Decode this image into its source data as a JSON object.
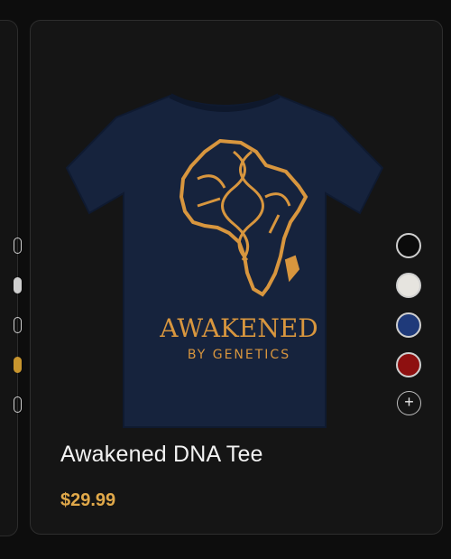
{
  "product": {
    "name": "Awakened DNA Tee",
    "price": "$29.99",
    "image_text_main": "AWAKENED",
    "image_text_sub": "BY GENETICS",
    "colors": [
      {
        "name": "black",
        "hex": "#0b0b0b"
      },
      {
        "name": "white",
        "hex": "#e6e4df"
      },
      {
        "name": "navy",
        "hex": "#1f3a7a"
      },
      {
        "name": "red",
        "hex": "#8e1010"
      }
    ],
    "more_colors_label": "+"
  },
  "colors": {
    "accent_price": "#e1a94a",
    "shirt": "#16233d",
    "print_gold": "#d8963e"
  }
}
